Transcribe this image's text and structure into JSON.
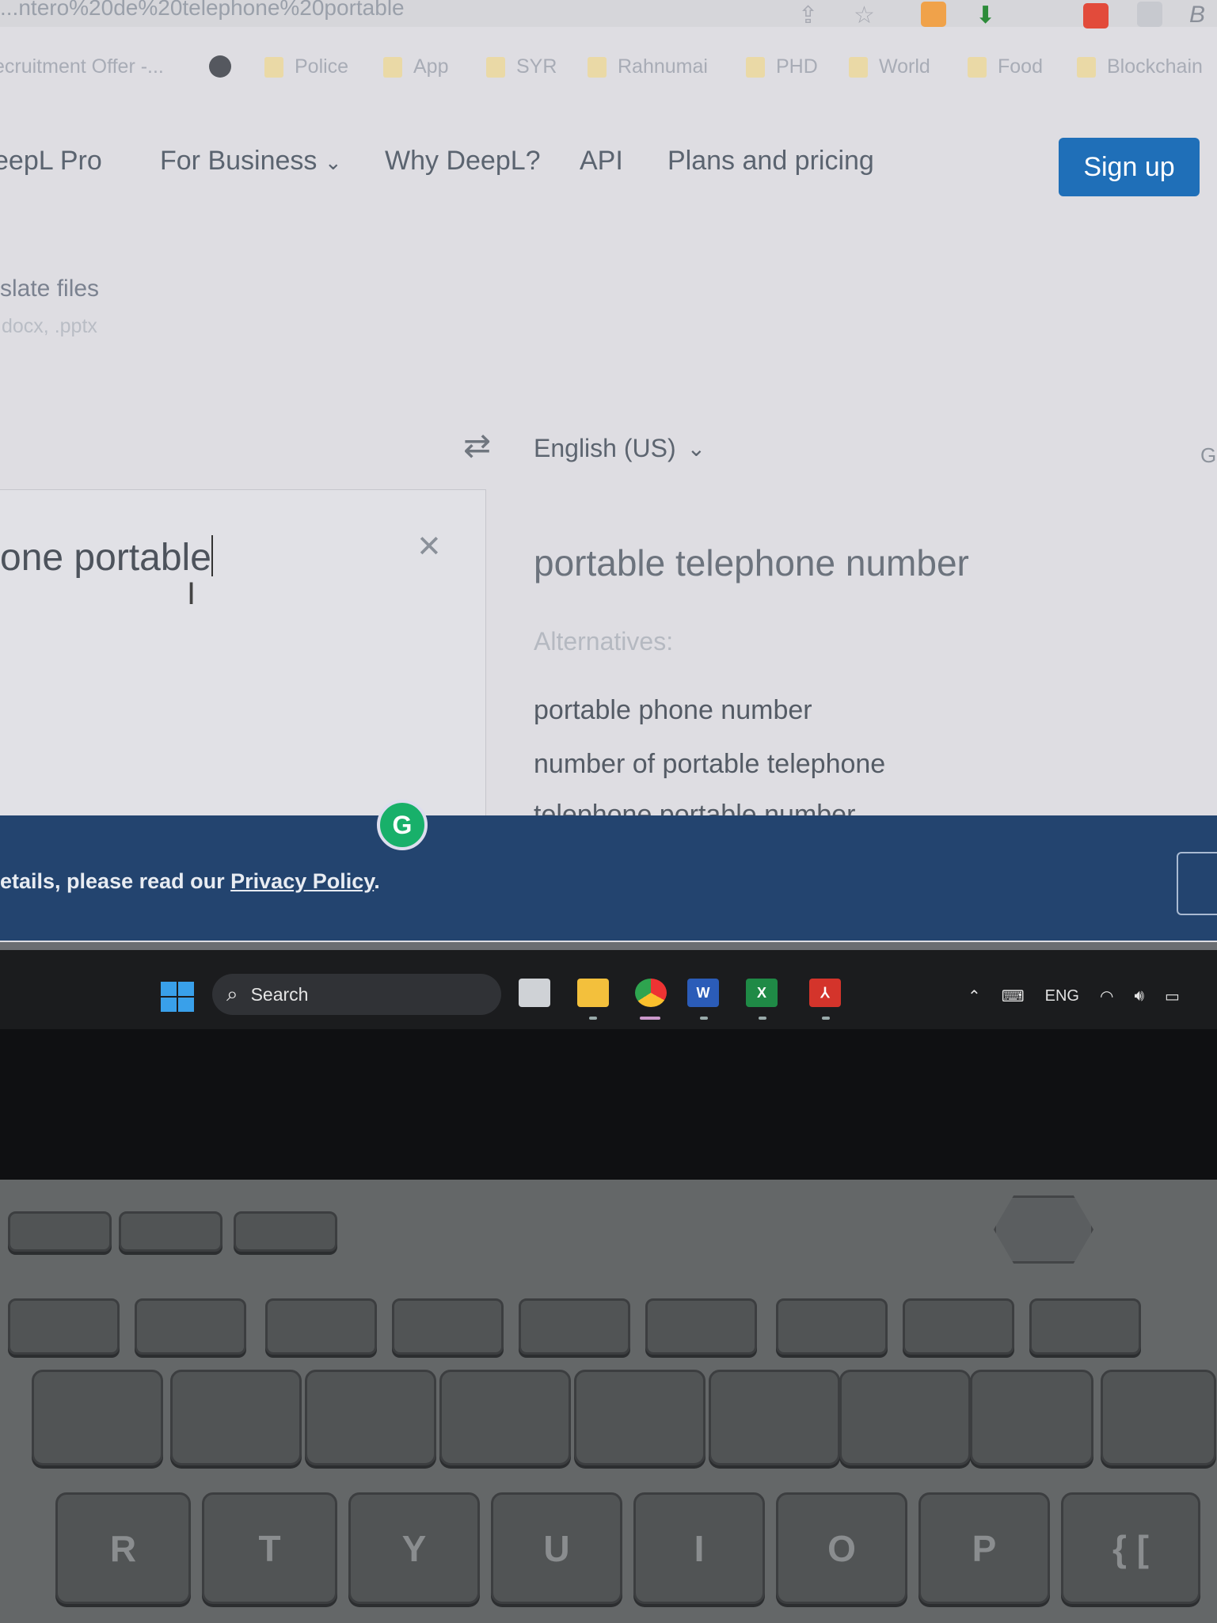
{
  "browser": {
    "url_fragment": "...ntero%20de%20telephone%20portable",
    "bookmarks": [
      {
        "label": "ecruitment Offer -..."
      },
      {
        "label": "Police"
      },
      {
        "label": "App"
      },
      {
        "label": "SYR"
      },
      {
        "label": "Rahnumai"
      },
      {
        "label": "PHD"
      },
      {
        "label": "World"
      },
      {
        "label": "Food"
      },
      {
        "label": "Blockchain"
      }
    ]
  },
  "site_nav": {
    "items": [
      "eepL Pro",
      "For Business",
      "Why DeepL?",
      "API",
      "Plans and pricing"
    ],
    "signup_label": "Sign up"
  },
  "files": {
    "title": "slate files",
    "formats": "docx, .pptx"
  },
  "translator": {
    "target_language": "English (US)",
    "source_text": "one portable",
    "result": "portable telephone number",
    "alternatives_label": "Alternatives:",
    "alternatives": [
      "portable phone number",
      "number of portable telephone",
      "telephone portable number"
    ]
  },
  "cookie_banner": {
    "text": "etails, please read our ",
    "link": "Privacy Policy",
    "suffix": "."
  },
  "taskbar": {
    "search_label": "Search",
    "language": "ENG",
    "apps": [
      "task-view",
      "file-explorer",
      "chrome",
      "word",
      "excel",
      "acrobat"
    ]
  },
  "keyboard": {
    "letter_row": [
      "R",
      "T",
      "Y",
      "U",
      "I",
      "O",
      "P",
      "{ ["
    ]
  },
  "colors": {
    "accent": "#1f6fb8",
    "cookie_bg": "#23446f",
    "grammarly": "#18b06a"
  }
}
